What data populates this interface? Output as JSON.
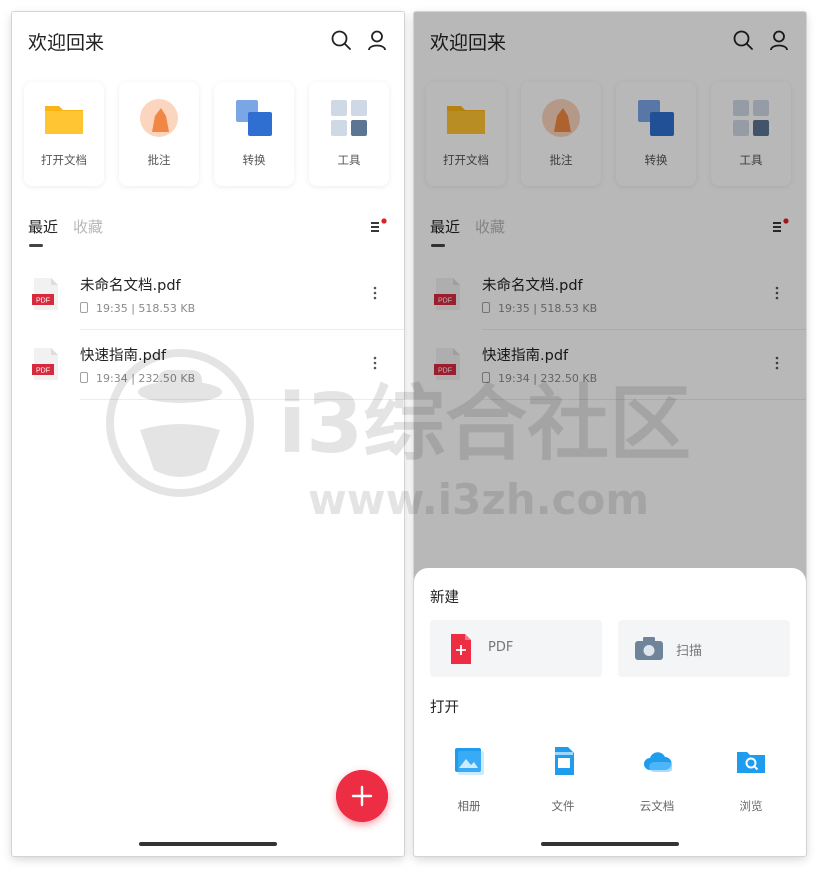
{
  "header": {
    "title": "欢迎回来"
  },
  "quick_actions": [
    {
      "label": "打开文档",
      "icon": "folder-icon"
    },
    {
      "label": "批注",
      "icon": "annotate-icon"
    },
    {
      "label": "转换",
      "icon": "convert-icon"
    },
    {
      "label": "工具",
      "icon": "tools-icon"
    }
  ],
  "tabs": {
    "recent": "最近",
    "favorites": "收藏"
  },
  "files": [
    {
      "name": "未命名文档.pdf",
      "meta": "19:35 | 518.53 KB",
      "badge": "PDF"
    },
    {
      "name": "快速指南.pdf",
      "meta": "19:34 | 232.50 KB",
      "badge": "PDF"
    }
  ],
  "sheet": {
    "new_title": "新建",
    "new_pdf": "PDF",
    "scan": "扫描",
    "open_title": "打开",
    "open_options": [
      {
        "label": "相册",
        "icon": "album-icon"
      },
      {
        "label": "文件",
        "icon": "file-icon"
      },
      {
        "label": "云文档",
        "icon": "cloud-icon"
      },
      {
        "label": "浏览",
        "icon": "browse-icon"
      }
    ]
  },
  "watermark": {
    "title": "i3综合社区",
    "url": "www.i3zh.com"
  },
  "colors": {
    "accent": "#ec2d43",
    "folder": "#fbb416",
    "convert": "#2f6fd1",
    "annotate": "#f08843"
  }
}
